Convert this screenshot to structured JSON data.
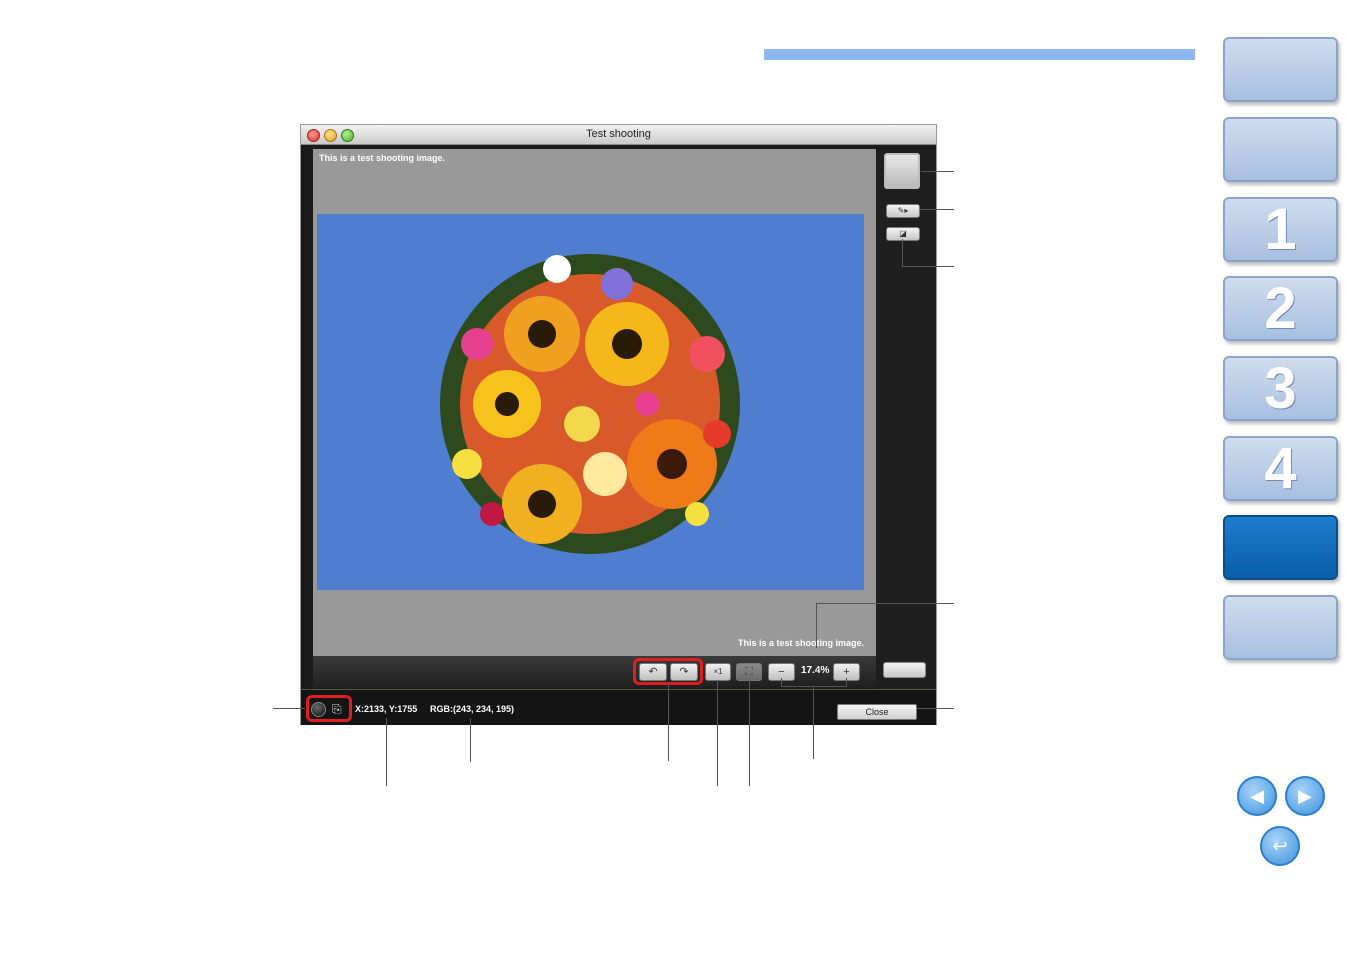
{
  "window": {
    "title": "Test shooting",
    "viewer_overlay_top": "This is a test shooting image.",
    "viewer_overlay_bottom": "This is a test shooting image.",
    "zoom_level": "17.4%",
    "coords": "X:2133, Y:1755",
    "rgb": "RGB:(243, 234, 195)",
    "close_label": "Close"
  },
  "toolbar": {
    "rotate_left_icon": "↶",
    "rotate_right_icon": "↷",
    "actual_size_icon": "×1",
    "fit_icon": "⛶",
    "zoom_out_icon": "−",
    "zoom_in_icon": "+"
  },
  "tabs": [
    "",
    "",
    "1",
    "2",
    "3",
    "4",
    "",
    ""
  ],
  "nav": {
    "prev": "◀",
    "next": "▶",
    "back": "↩"
  },
  "colors": {
    "accent": "#8eb7f0",
    "tab_active": "#0a5fa8",
    "highlight": "#e01e1e"
  }
}
